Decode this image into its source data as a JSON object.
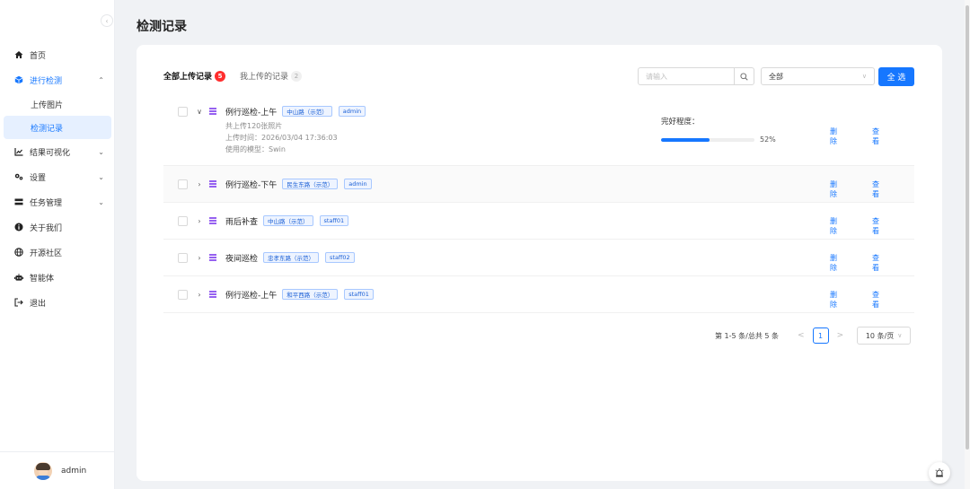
{
  "sidebar": {
    "collapse_icon": "chevron-left-icon",
    "menu": [
      {
        "label": "首页",
        "icon": "home-icon"
      },
      {
        "label": "进行检测",
        "icon": "box-icon",
        "arrow": "⌃",
        "children": [
          {
            "label": "上传图片"
          },
          {
            "label": "检测记录",
            "selected": true
          }
        ]
      },
      {
        "label": "结果可视化",
        "icon": "chart-icon",
        "arrow": "⌄"
      },
      {
        "label": "设置",
        "icon": "gears-icon",
        "arrow": "⌄"
      },
      {
        "label": "任务管理",
        "icon": "tasks-icon",
        "arrow": "⌄"
      },
      {
        "label": "关于我们",
        "icon": "info-icon"
      },
      {
        "label": "开源社区",
        "icon": "globe-icon"
      },
      {
        "label": "智能体",
        "icon": "robot-icon"
      },
      {
        "label": "退出",
        "icon": "logout-icon"
      }
    ],
    "user": {
      "name": "admin"
    }
  },
  "page": {
    "title": "检测记录"
  },
  "tabs": [
    {
      "label": "全部上传记录",
      "count": "5",
      "active": true
    },
    {
      "label": "我上传的记录",
      "count": "2",
      "active": false
    }
  ],
  "search": {
    "placeholder": "请输入",
    "value": ""
  },
  "filter": {
    "selected": "全部"
  },
  "select_all_label": "全 选",
  "colors": {
    "accent": "#1677ff",
    "badge": "#ff2d2d",
    "list_icon": "#7c3aed"
  },
  "records": [
    {
      "title": "例行巡检-上午",
      "tags": [
        "中山路（示范）",
        "admin"
      ],
      "expanded": true,
      "meta": [
        "共上传120张照片",
        "上传时间：2026/03/04 17:36:03",
        "使用的模型：Swin"
      ],
      "progress_label": "完好程度：",
      "progress": 52,
      "progress_text": "52%"
    },
    {
      "title": "例行巡检-下午",
      "tags": [
        "民生东路（示范）",
        "admin"
      ],
      "expanded": false,
      "highlight": true
    },
    {
      "title": "雨后补查",
      "tags": [
        "中山路（示范）",
        "staff01"
      ],
      "expanded": false
    },
    {
      "title": "夜间巡检",
      "tags": [
        "忠孝东路（示范）",
        "staff02"
      ],
      "expanded": false
    },
    {
      "title": "例行巡检-上午",
      "tags": [
        "和平西路（示范）",
        "staff01"
      ],
      "expanded": false
    }
  ],
  "actions": {
    "delete": "删除",
    "view": "查看"
  },
  "pagination": {
    "total": "第 1-5 条/总共 5 条",
    "current": "1",
    "prev": "<",
    "next": ">",
    "page_size": "10 条/页"
  }
}
